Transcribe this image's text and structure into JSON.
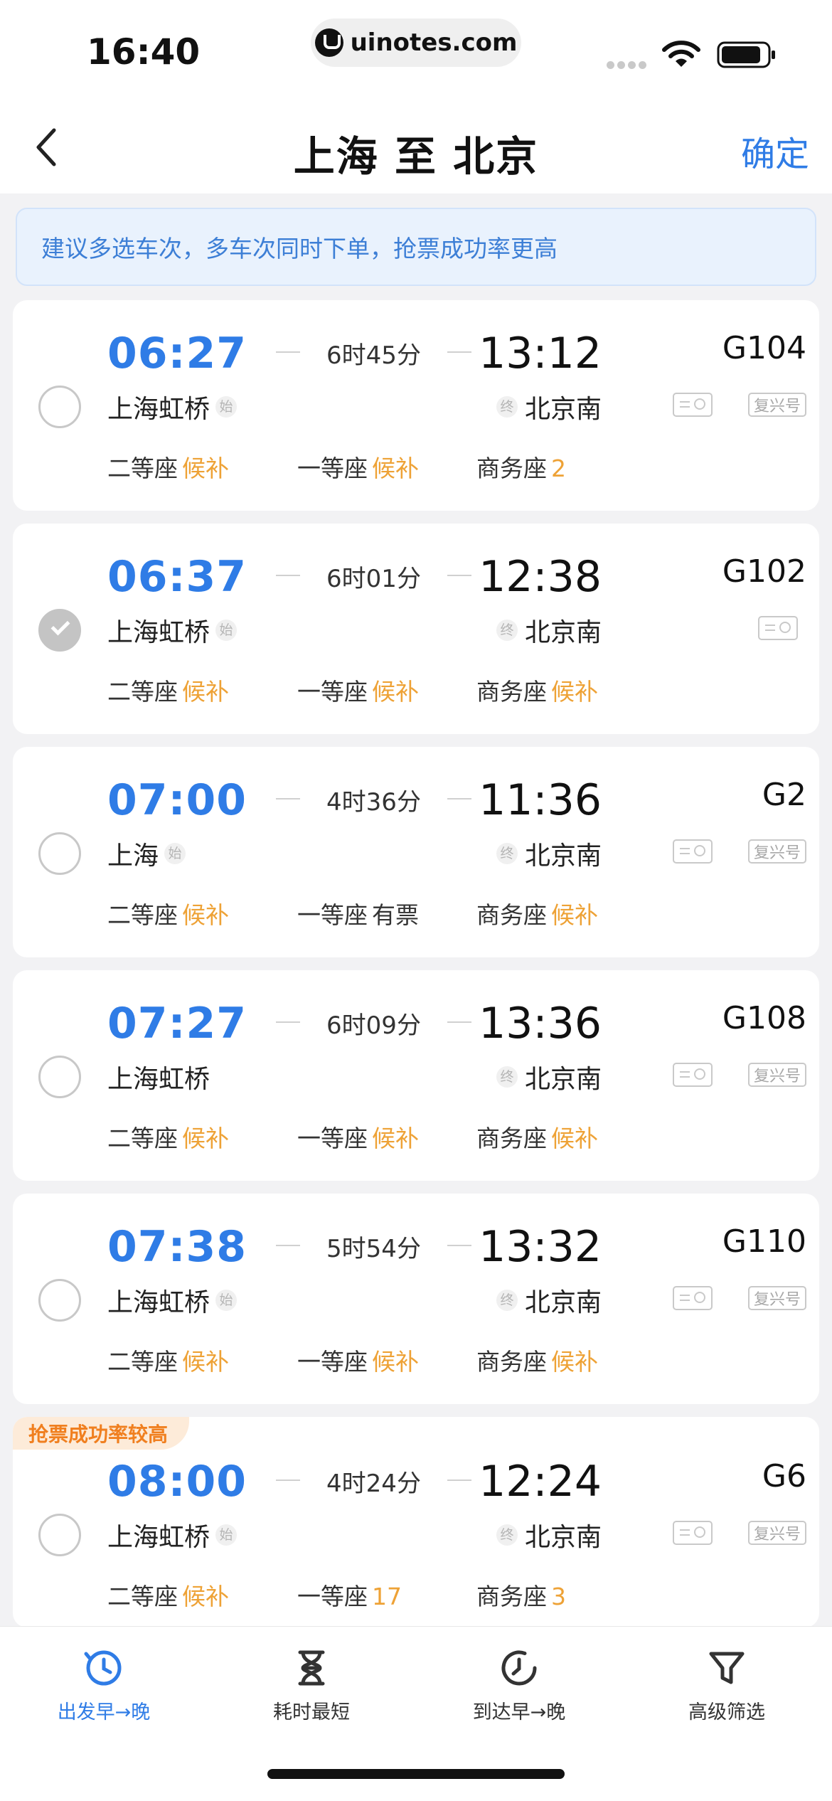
{
  "status_bar": {
    "time": "16:40",
    "url": "uinotes.com"
  },
  "nav": {
    "title": "上海 至 北京",
    "confirm_label": "确定"
  },
  "tip": {
    "text": "建议多选车次，多车次同时下单，抢票成功率更高"
  },
  "trains": [
    {
      "dep_time": "06:27",
      "duration": "6时45分",
      "arr_time": "13:12",
      "train_no": "G104",
      "dep_station": "上海虹桥",
      "dep_tag": "始",
      "arr_station": "北京南",
      "arr_tag": "终",
      "fuxing": "复兴号",
      "selected": false,
      "badge": "",
      "seats": [
        {
          "name": "二等座",
          "value": "候补"
        },
        {
          "name": "一等座",
          "value": "候补"
        },
        {
          "name": "商务座",
          "value": "2"
        }
      ]
    },
    {
      "dep_time": "06:37",
      "duration": "6时01分",
      "arr_time": "12:38",
      "train_no": "G102",
      "dep_station": "上海虹桥",
      "dep_tag": "始",
      "arr_station": "北京南",
      "arr_tag": "终",
      "fuxing": "",
      "selected": true,
      "badge": "",
      "seats": [
        {
          "name": "二等座",
          "value": "候补"
        },
        {
          "name": "一等座",
          "value": "候补"
        },
        {
          "name": "商务座",
          "value": "候补"
        }
      ]
    },
    {
      "dep_time": "07:00",
      "duration": "4时36分",
      "arr_time": "11:36",
      "train_no": "G2",
      "dep_station": "上海",
      "dep_tag": "始",
      "arr_station": "北京南",
      "arr_tag": "终",
      "fuxing": "复兴号",
      "selected": false,
      "badge": "",
      "seats": [
        {
          "name": "二等座",
          "value": "候补"
        },
        {
          "name": "一等座",
          "value": "有票"
        },
        {
          "name": "商务座",
          "value": "候补"
        }
      ]
    },
    {
      "dep_time": "07:27",
      "duration": "6时09分",
      "arr_time": "13:36",
      "train_no": "G108",
      "dep_station": "上海虹桥",
      "dep_tag": "",
      "arr_station": "北京南",
      "arr_tag": "终",
      "fuxing": "复兴号",
      "selected": false,
      "badge": "",
      "seats": [
        {
          "name": "二等座",
          "value": "候补"
        },
        {
          "name": "一等座",
          "value": "候补"
        },
        {
          "name": "商务座",
          "value": "候补"
        }
      ]
    },
    {
      "dep_time": "07:38",
      "duration": "5时54分",
      "arr_time": "13:32",
      "train_no": "G110",
      "dep_station": "上海虹桥",
      "dep_tag": "始",
      "arr_station": "北京南",
      "arr_tag": "终",
      "fuxing": "复兴号",
      "selected": false,
      "badge": "",
      "seats": [
        {
          "name": "二等座",
          "value": "候补"
        },
        {
          "name": "一等座",
          "value": "候补"
        },
        {
          "name": "商务座",
          "value": "候补"
        }
      ]
    },
    {
      "dep_time": "08:00",
      "duration": "4时24分",
      "arr_time": "12:24",
      "train_no": "G6",
      "dep_station": "上海虹桥",
      "dep_tag": "始",
      "arr_station": "北京南",
      "arr_tag": "终",
      "fuxing": "复兴号",
      "selected": false,
      "badge": "抢票成功率较高",
      "seats": [
        {
          "name": "二等座",
          "value": "候补"
        },
        {
          "name": "一等座",
          "value": "17"
        },
        {
          "name": "商务座",
          "value": "3"
        }
      ]
    }
  ],
  "tabs": [
    {
      "label": "出发早→晚",
      "icon": "clock-icon",
      "active": true
    },
    {
      "label": "耗时最短",
      "icon": "hourglass-icon",
      "active": false
    },
    {
      "label": "到达早→晚",
      "icon": "arrival-clock-icon",
      "active": false
    },
    {
      "label": "高级筛选",
      "icon": "filter-icon",
      "active": false
    }
  ],
  "colors": {
    "accent": "#2f7ce6",
    "waitlist": "#eea236",
    "badge_text": "#f07f1f"
  }
}
